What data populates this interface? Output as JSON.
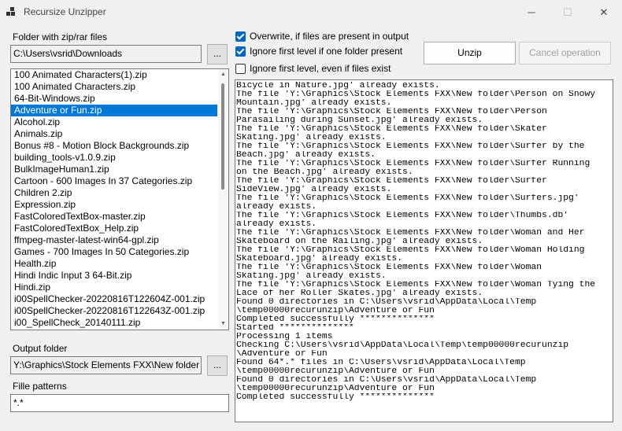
{
  "window": {
    "title": "Recursize Unzipper",
    "minimize_glyph": "─",
    "maximize_glyph": "☐",
    "close_glyph": "✕"
  },
  "folder": {
    "label": "Folder with zip/rar files",
    "value": "C:\\Users\\vsrid\\Downloads",
    "browse_label": "..."
  },
  "files": {
    "selected_index": 3,
    "items": [
      "100 Animated Characters(1).zip",
      "100 Animated Characters.zip",
      "64-Bit-Windows.zip",
      "Adventure or Fun.zip",
      "Alcohol.zip",
      "Animals.zip",
      "Bonus #8 - Motion Block Backgrounds.zip",
      "building_tools-v1.0.9.zip",
      "BulkImageHuman1.zip",
      "Cartoon - 600 Images In 37 Categories.zip",
      "Children 2.zip",
      "Expression.zip",
      "FastColoredTextBox-master.zip",
      "FastColoredTextBox_Help.zip",
      "ffmpeg-master-latest-win64-gpl.zip",
      "Games - 700 Images In 50 Categories.zip",
      "Health.zip",
      "Hindi Indic Input 3 64-Bit.zip",
      "Hindi.zip",
      "i00SpellChecker-20220816T122604Z-001.zip",
      "i00SpellChecker-20220816T122643Z-001.zip",
      "i00_SpellCheck_20140111.zip"
    ]
  },
  "output": {
    "label": "Output folder",
    "value": "Y:\\Graphics\\Stock Elements FXX\\New folder",
    "browse_label": "..."
  },
  "patterns": {
    "label": "Fille patterns",
    "value": "*.*"
  },
  "options": {
    "overwrite": {
      "label": "Overwrite, if files are present in output",
      "checked": true
    },
    "ignore_one": {
      "label": "Ignore first level if one folder present",
      "checked": true
    },
    "ignore_always": {
      "label": "Ignore first level, even if files exist",
      "checked": false
    }
  },
  "actions": {
    "unzip_label": "Unzip",
    "cancel_label": "Cancel operation"
  },
  "log": {
    "lines": [
      "Bicycle in Nature.jpg' already exists.",
      "The file 'Y:\\Graphics\\Stock Elements FXX\\New folder\\Person on Snowy",
      "Mountain.jpg' already exists.",
      "The file 'Y:\\Graphics\\Stock Elements FXX\\New folder\\Person",
      "Parasailing during Sunset.jpg' already exists.",
      "The file 'Y:\\Graphics\\Stock Elements FXX\\New folder\\Skater",
      "Skating.jpg' already exists.",
      "The file 'Y:\\Graphics\\Stock Elements FXX\\New folder\\Surfer by the",
      "Beach.jpg' already exists.",
      "The file 'Y:\\Graphics\\Stock Elements FXX\\New folder\\Surfer Running",
      "on the Beach.jpg' already exists.",
      "The file 'Y:\\Graphics\\Stock Elements FXX\\New folder\\Surfer",
      "SideView.jpg' already exists.",
      "The file 'Y:\\Graphics\\Stock Elements FXX\\New folder\\Surfers.jpg'",
      "already exists.",
      "The file 'Y:\\Graphics\\Stock Elements FXX\\New folder\\Thumbs.db'",
      "already exists.",
      "The file 'Y:\\Graphics\\Stock Elements FXX\\New folder\\Woman and Her",
      "Skateboard on the Railing.jpg' already exists.",
      "The file 'Y:\\Graphics\\Stock Elements FXX\\New folder\\Woman Holding",
      "Skateboard.jpg' already exists.",
      "The file 'Y:\\Graphics\\Stock Elements FXX\\New folder\\Woman",
      "Skating.jpg' already exists.",
      "The file 'Y:\\Graphics\\Stock Elements FXX\\New folder\\Woman Tying the",
      "Lace of her Roller Skates.jpg' already exists.",
      "Found 0 directories in C:\\Users\\vsrid\\AppData\\Local\\Temp",
      "\\temp00000recurunzip\\Adventure or Fun",
      "Completed successfully **************",
      "Started **************",
      "Processing 1 items",
      "Checking C:\\Users\\vsrid\\AppData\\Local\\Temp\\temp00000recurunzip",
      "\\Adventure or Fun",
      "Found 64*.* files in C:\\Users\\vsrid\\AppData\\Local\\Temp",
      "\\temp00000recurunzip\\Adventure or Fun",
      "Found 0 directories in C:\\Users\\vsrid\\AppData\\Local\\Temp",
      "\\temp00000recurunzip\\Adventure or Fun",
      "Completed successfully **************"
    ]
  }
}
